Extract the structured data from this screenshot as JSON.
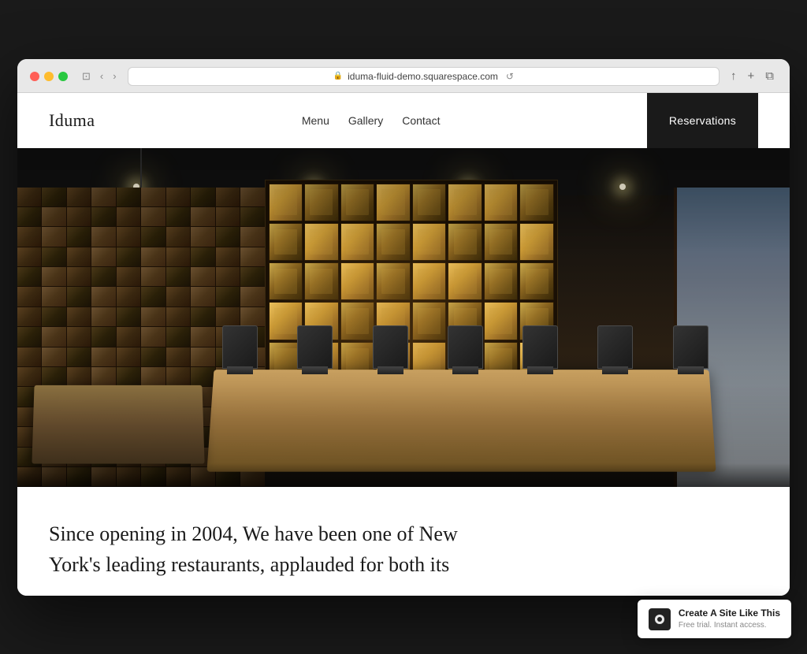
{
  "browser": {
    "url": "iduma-fluid-demo.squarespace.com",
    "back_btn": "‹",
    "forward_btn": "›",
    "window_icon": "⊡",
    "share_icon": "↑",
    "add_tab_icon": "+",
    "duplicate_icon": "⧉",
    "refresh_icon": "↺",
    "lock_icon": "🔒"
  },
  "site": {
    "logo": "Iduma",
    "nav": {
      "links": [
        "Menu",
        "Gallery",
        "Contact"
      ]
    },
    "reservations_btn": "Reservations"
  },
  "hero": {
    "alt": "Restaurant interior with wine rack and dining tables"
  },
  "body_text": {
    "line1": "Since opening in 2004, We have been one of New",
    "line2": "York's leading restaurants, applauded for both its"
  },
  "badge": {
    "title": "Create A Site Like This",
    "subtitle": "Free trial. Instant access.",
    "logo_char": "■"
  },
  "colors": {
    "accent": "#1a1a1a",
    "reservations_bg": "#1a1a1a",
    "reservations_text": "#ffffff"
  }
}
